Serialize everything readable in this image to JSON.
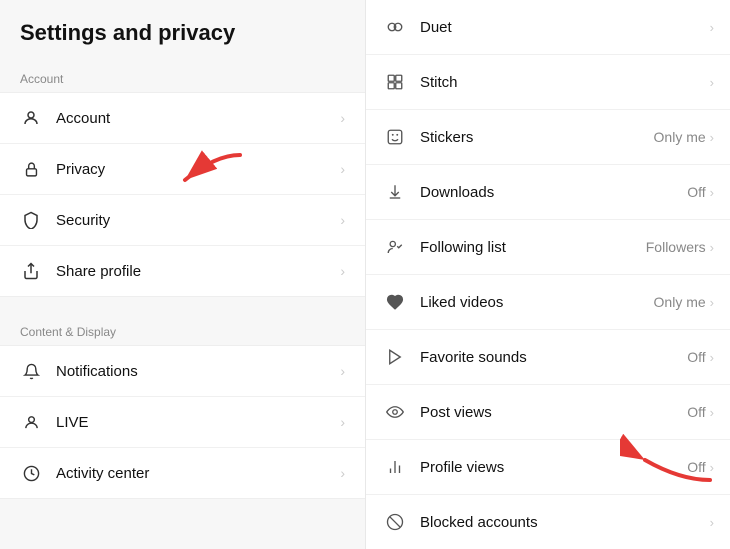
{
  "left": {
    "title": "Settings and privacy",
    "sections": [
      {
        "label": "Account",
        "items": [
          {
            "id": "account",
            "label": "Account",
            "icon": "👤"
          },
          {
            "id": "privacy",
            "label": "Privacy",
            "icon": "🔒",
            "active": true
          },
          {
            "id": "security",
            "label": "Security",
            "icon": "🛡"
          },
          {
            "id": "share-profile",
            "label": "Share profile",
            "icon": "↗"
          }
        ]
      },
      {
        "label": "Content & Display",
        "items": [
          {
            "id": "notifications",
            "label": "Notifications",
            "icon": "🔔"
          },
          {
            "id": "live",
            "label": "LIVE",
            "icon": "👤"
          },
          {
            "id": "activity-center",
            "label": "Activity center",
            "icon": "🕐"
          }
        ]
      }
    ]
  },
  "right": {
    "items": [
      {
        "id": "duet",
        "label": "Duet",
        "value": "",
        "icon": "duet"
      },
      {
        "id": "stitch",
        "label": "Stitch",
        "value": "",
        "icon": "stitch"
      },
      {
        "id": "stickers",
        "label": "Stickers",
        "value": "Only me",
        "icon": "stickers"
      },
      {
        "id": "downloads",
        "label": "Downloads",
        "value": "Off",
        "icon": "downloads"
      },
      {
        "id": "following-list",
        "label": "Following list",
        "value": "Followers",
        "icon": "following"
      },
      {
        "id": "liked-videos",
        "label": "Liked videos",
        "value": "Only me",
        "icon": "liked"
      },
      {
        "id": "favorite-sounds",
        "label": "Favorite sounds",
        "value": "Off",
        "icon": "favorite"
      },
      {
        "id": "post-views",
        "label": "Post views",
        "value": "Off",
        "icon": "post-views"
      },
      {
        "id": "profile-views",
        "label": "Profile views",
        "value": "Off",
        "icon": "profile-views"
      },
      {
        "id": "blocked-accounts",
        "label": "Blocked accounts",
        "value": "",
        "icon": "blocked"
      }
    ]
  }
}
